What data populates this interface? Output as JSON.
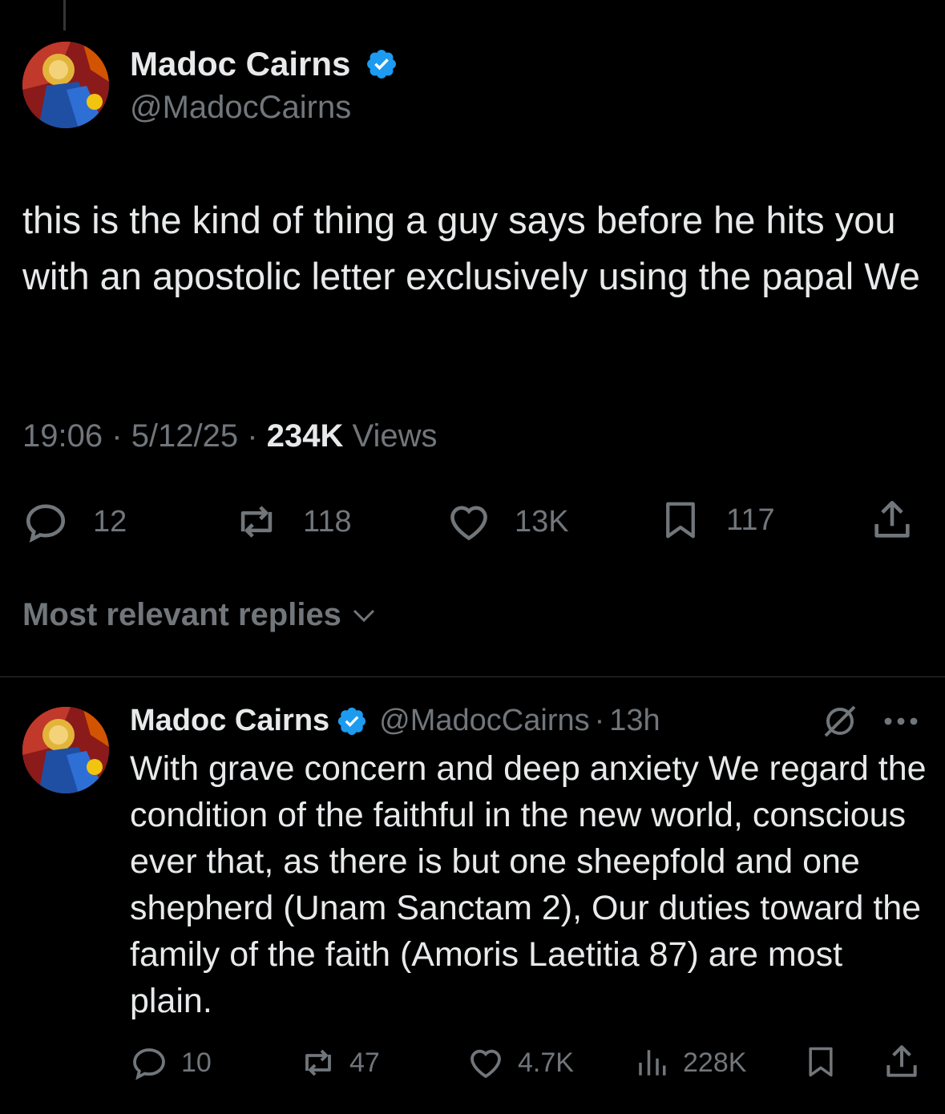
{
  "tweet": {
    "author_name": "Madoc Cairns",
    "author_handle": "@MadocCairns",
    "text": "this is the kind of thing a guy says before he hits you with an apostolic letter exclusively using the papal We",
    "time": "19:06",
    "date": "5/12/25",
    "views_count": "234K",
    "views_label": "Views",
    "replies": "12",
    "reposts": "118",
    "likes": "13K",
    "bookmarks": "117"
  },
  "sort_label": "Most relevant replies",
  "reply": {
    "author_name": "Madoc Cairns",
    "author_handle": "@MadocCairns",
    "age": "13h",
    "text": "With grave concern and deep anxiety We regard the condition of the faithful in the new world, conscious ever that, as there is but one sheepfold and one shepherd (Unam Sanctam 2), Our duties toward the family of the faith (Amoris Laetitia 87) are most plain.",
    "replies": "10",
    "reposts": "47",
    "likes": "4.7K",
    "views": "228K"
  },
  "colors": {
    "background": "#000000",
    "text": "#e7e9ea",
    "muted": "#71767b",
    "verified": "#1d9bf0"
  }
}
